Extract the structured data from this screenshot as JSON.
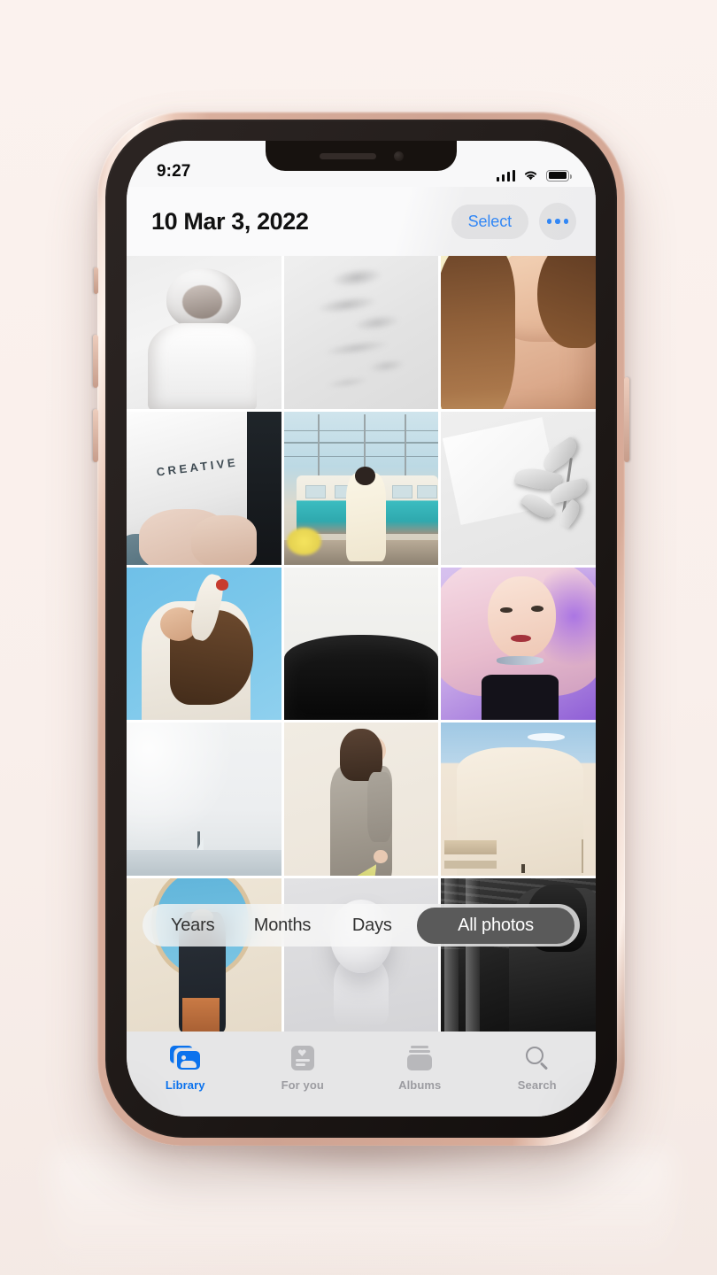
{
  "background": {
    "color": "#f9efeb"
  },
  "device": {
    "frame_color": "#cfa392",
    "bezel_color": "#1a1513",
    "notch": {
      "speaker": "speaker-grille",
      "camera": "front-camera"
    },
    "side_buttons": [
      "mute-switch",
      "volume-up",
      "volume-down",
      "power-button"
    ]
  },
  "status_bar": {
    "time": "9:27",
    "icons": [
      "cellular-signal-icon",
      "wifi-icon",
      "battery-icon"
    ],
    "battery_full": true
  },
  "header": {
    "title": "10 Mar 3, 2022",
    "select_label": "Select",
    "more_label": "more-options",
    "accent_color": "#3287f5"
  },
  "grid": {
    "columns": 3,
    "rows": 5,
    "photos": [
      {
        "id": "photo-1",
        "alt": "Woman in white tee with arms raised, black and white"
      },
      {
        "id": "photo-2",
        "alt": "Palm frond shadows on a white wall"
      },
      {
        "id": "photo-3",
        "alt": "Woman with long brown hair, bare shoulder, cream background"
      },
      {
        "id": "photo-4",
        "alt": "Person in white CREATIVE t-shirt"
      },
      {
        "id": "photo-5",
        "alt": "Woman standing by a teal and white train"
      },
      {
        "id": "photo-6",
        "alt": "White leaves casting shadows on paper"
      },
      {
        "id": "photo-7",
        "alt": "Woman stretching against a blue sky"
      },
      {
        "id": "photo-8",
        "alt": "Black sand dune against white sky"
      },
      {
        "id": "photo-9",
        "alt": "Woman with pink and lilac hair in purple light"
      },
      {
        "id": "photo-10",
        "alt": "Minimal seascape with a distant sailboat"
      },
      {
        "id": "photo-11",
        "alt": "Woman in a grey dress holding a stem"
      },
      {
        "id": "photo-12",
        "alt": "Cream curved wall under a blue sky"
      },
      {
        "id": "photo-13",
        "alt": "Person framed by a round mirror with sky"
      },
      {
        "id": "photo-14",
        "alt": "White sphere sculpture on a grey plinth"
      },
      {
        "id": "photo-15",
        "alt": "Black and white portrait beside stone columns"
      }
    ]
  },
  "segmented_control": {
    "options": [
      "Years",
      "Months",
      "Days",
      "All photos"
    ],
    "selected": "All photos",
    "selected_bg": "#5a5a5a"
  },
  "tab_bar": {
    "items": [
      {
        "label": "Library",
        "icon": "photo-stack-icon",
        "active": true
      },
      {
        "label": "For you",
        "icon": "memories-card-icon",
        "active": false
      },
      {
        "label": "Albums",
        "icon": "albums-box-icon",
        "active": false
      },
      {
        "label": "Search",
        "icon": "magnifier-icon",
        "active": false
      }
    ],
    "active_color": "#0b72ed",
    "inactive_color": "#9c9ca1"
  }
}
